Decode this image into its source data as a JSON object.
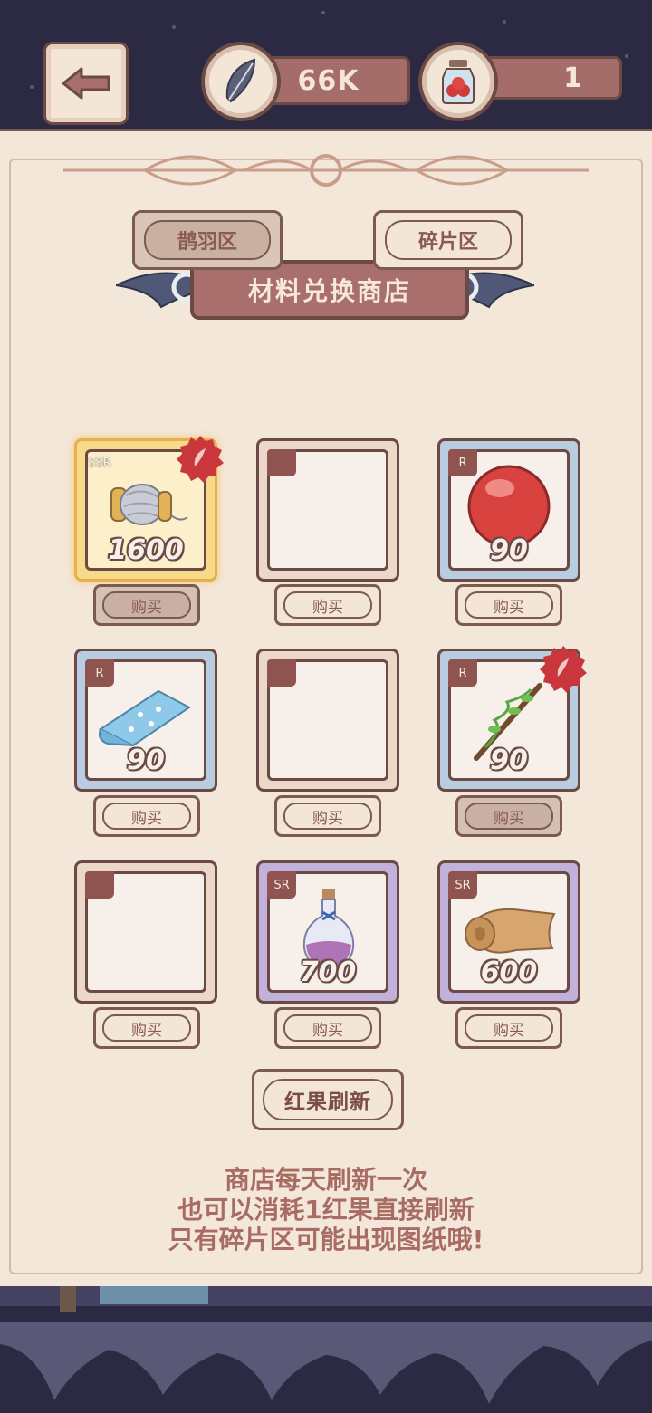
{
  "header": {
    "back_icon": "arrow-left-icon",
    "feather": {
      "icon": "feather-icon",
      "value": "66K"
    },
    "berry": {
      "icon": "berry-jar-icon",
      "value": "1"
    }
  },
  "shop": {
    "title": "材料兑换商店",
    "tabs": [
      {
        "label": "鹊羽区",
        "active": true
      },
      {
        "label": "碎片区",
        "active": false
      }
    ],
    "items": [
      {
        "rarity": "SSR",
        "price": "1600",
        "icon": "thread-spool-icon",
        "sealed": true,
        "buy_label": "购买",
        "buy_disabled": true
      },
      {
        "rarity": "",
        "price": "",
        "icon": "",
        "sealed": false,
        "buy_label": "购买",
        "buy_disabled": false
      },
      {
        "rarity": "R",
        "price": "90",
        "icon": "red-ball-icon",
        "sealed": false,
        "buy_label": "购买",
        "buy_disabled": false
      },
      {
        "rarity": "R",
        "price": "90",
        "icon": "fabric-roll-icon",
        "sealed": false,
        "buy_label": "购买",
        "buy_disabled": false
      },
      {
        "rarity": "",
        "price": "",
        "icon": "",
        "sealed": false,
        "buy_label": "购买",
        "buy_disabled": false
      },
      {
        "rarity": "R",
        "price": "90",
        "icon": "rose-branch-icon",
        "sealed": true,
        "buy_label": "购买",
        "buy_disabled": true
      },
      {
        "rarity": "",
        "price": "",
        "icon": "",
        "sealed": false,
        "buy_label": "购买",
        "buy_disabled": false
      },
      {
        "rarity": "SR",
        "price": "700",
        "icon": "potion-bottle-icon",
        "sealed": false,
        "buy_label": "购买",
        "buy_disabled": false
      },
      {
        "rarity": "SR",
        "price": "600",
        "icon": "parchment-roll-icon",
        "sealed": false,
        "buy_label": "购买",
        "buy_disabled": false
      }
    ],
    "refresh_label": "红果刷新",
    "notice": [
      "商店每天刷新一次",
      "也可以消耗1红果直接刷新",
      "只有碎片区可能出现图纸哦!"
    ]
  },
  "colors": {
    "parchment": "#f3e7da",
    "accent": "#a86f6c",
    "outline": "#6b4a45",
    "rarity_r": "#b9cde0",
    "rarity_sr": "#c1b1db",
    "rarity_ssr": "#f7d98a"
  }
}
